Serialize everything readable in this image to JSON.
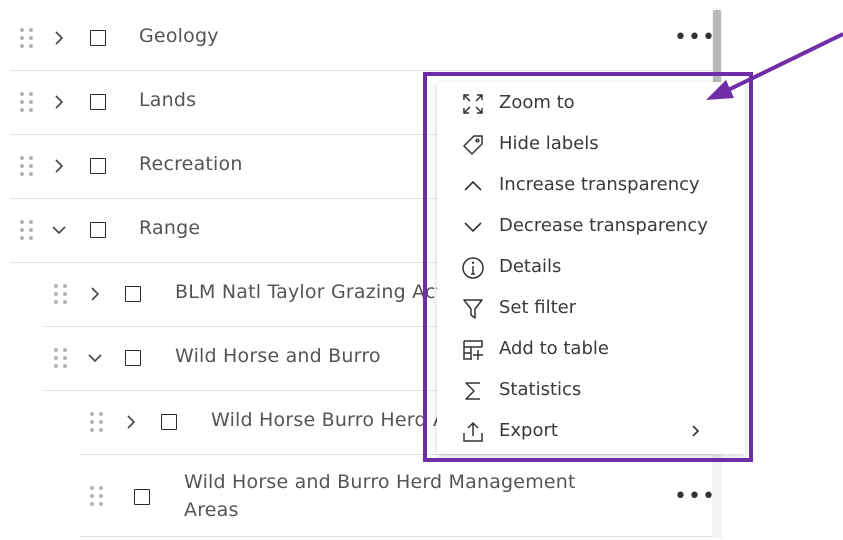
{
  "layers": [
    {
      "name": "Geology",
      "expanded": false,
      "show_options": true
    },
    {
      "name": "Lands",
      "expanded": false
    },
    {
      "name": "Recreation",
      "expanded": false
    },
    {
      "name": "Range",
      "expanded": true
    },
    {
      "name": "BLM Natl Taylor Grazing Act",
      "expanded": false
    },
    {
      "name": "Wild Horse and Burro",
      "expanded": true
    },
    {
      "name": "Wild Horse Burro Herd Area",
      "expanded": false
    },
    {
      "name": "Wild Horse and Burro Herd Management Areas",
      "show_options": true
    }
  ],
  "options_glyph": "•••",
  "context_menu": {
    "items": [
      {
        "label": "Zoom to",
        "icon": "zoom-to-icon"
      },
      {
        "label": "Hide labels",
        "icon": "tag-icon"
      },
      {
        "label": "Increase transparency",
        "icon": "chevron-up-icon"
      },
      {
        "label": "Decrease transparency",
        "icon": "chevron-down-icon"
      },
      {
        "label": "Details",
        "icon": "info-icon"
      },
      {
        "label": "Set filter",
        "icon": "filter-icon"
      },
      {
        "label": "Add to table",
        "icon": "add-to-table-icon"
      },
      {
        "label": "Statistics",
        "icon": "sigma-icon"
      },
      {
        "label": "Export",
        "icon": "export-icon",
        "has_submenu": true
      }
    ]
  },
  "annotation": {
    "color": "#6f2da8"
  }
}
